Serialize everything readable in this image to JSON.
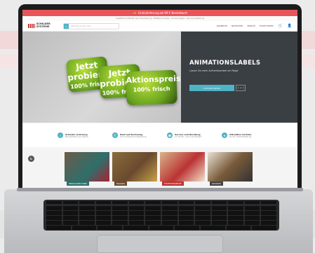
{
  "colors": {
    "accent": "#4fb3c7",
    "promo_bar": "#e8545a",
    "hero_panel": "#3a3f44",
    "label_green": "#6aa41e"
  },
  "topbar": {
    "icon": "truck-icon",
    "text": "Gratislieferung ab 99 € Bestellwert"
  },
  "infobar": {
    "text": "Ungefähre Lieferzeit nach Vereinbarung · Etiketten drucken · Druckvorlagen · Service & Beratung"
  },
  "header": {
    "logo_text": "SCHILDER SYSTEME",
    "search_placeholder": "Wonach suchen Sie?",
    "search_icon": "search-icon",
    "nav": [
      "ANGEBOTE",
      "NEUHEITEN",
      "SERVICE",
      "ETIKETTIERER"
    ],
    "cart_icon": "cart-icon",
    "account_icon": "user-icon"
  },
  "hero": {
    "labels": [
      {
        "line1": "Jetzt",
        "line2": "probieren",
        "line3": "100% frisch"
      },
      {
        "line1": "Jetzt",
        "line2": "probieren",
        "line3": "100% frisch"
      },
      {
        "line1": "Aktionspreis",
        "line2": "100% frisch"
      }
    ],
    "title": "ANIMATIONSLABELS",
    "subtitle": "Lassen Sie mehr Aufmerksamkeit am Regal",
    "button": "Animationslabels",
    "more": "• • •"
  },
  "usps": [
    {
      "icon": "check-icon",
      "title": "Schnelle Lieferung",
      "sub": "Expresslieferung möglich"
    },
    {
      "icon": "invoice-icon",
      "title": "Kauf auf Rechnung",
      "sub": "Auch erfolgreiche Bestellung"
    },
    {
      "icon": "service-icon",
      "title": "Service und Beratung",
      "sub": "von Profis - auch nach Bedarf"
    },
    {
      "icon": "gift-icon",
      "title": "Attraktive Vorteile",
      "sub": "ab der 3.000 Bestellung"
    }
  ],
  "categories": {
    "side_icon": "wheelchair-icon",
    "tiles": [
      {
        "label": "PREISAUSZEICHNER",
        "color": "#2e6f6a"
      },
      {
        "label": "BAGGING",
        "color": "#6a4a2e"
      },
      {
        "label": "ETIKETTIERGERÄTE",
        "color": "#b33"
      },
      {
        "label": "DRUCKER",
        "color": "#444"
      }
    ]
  }
}
